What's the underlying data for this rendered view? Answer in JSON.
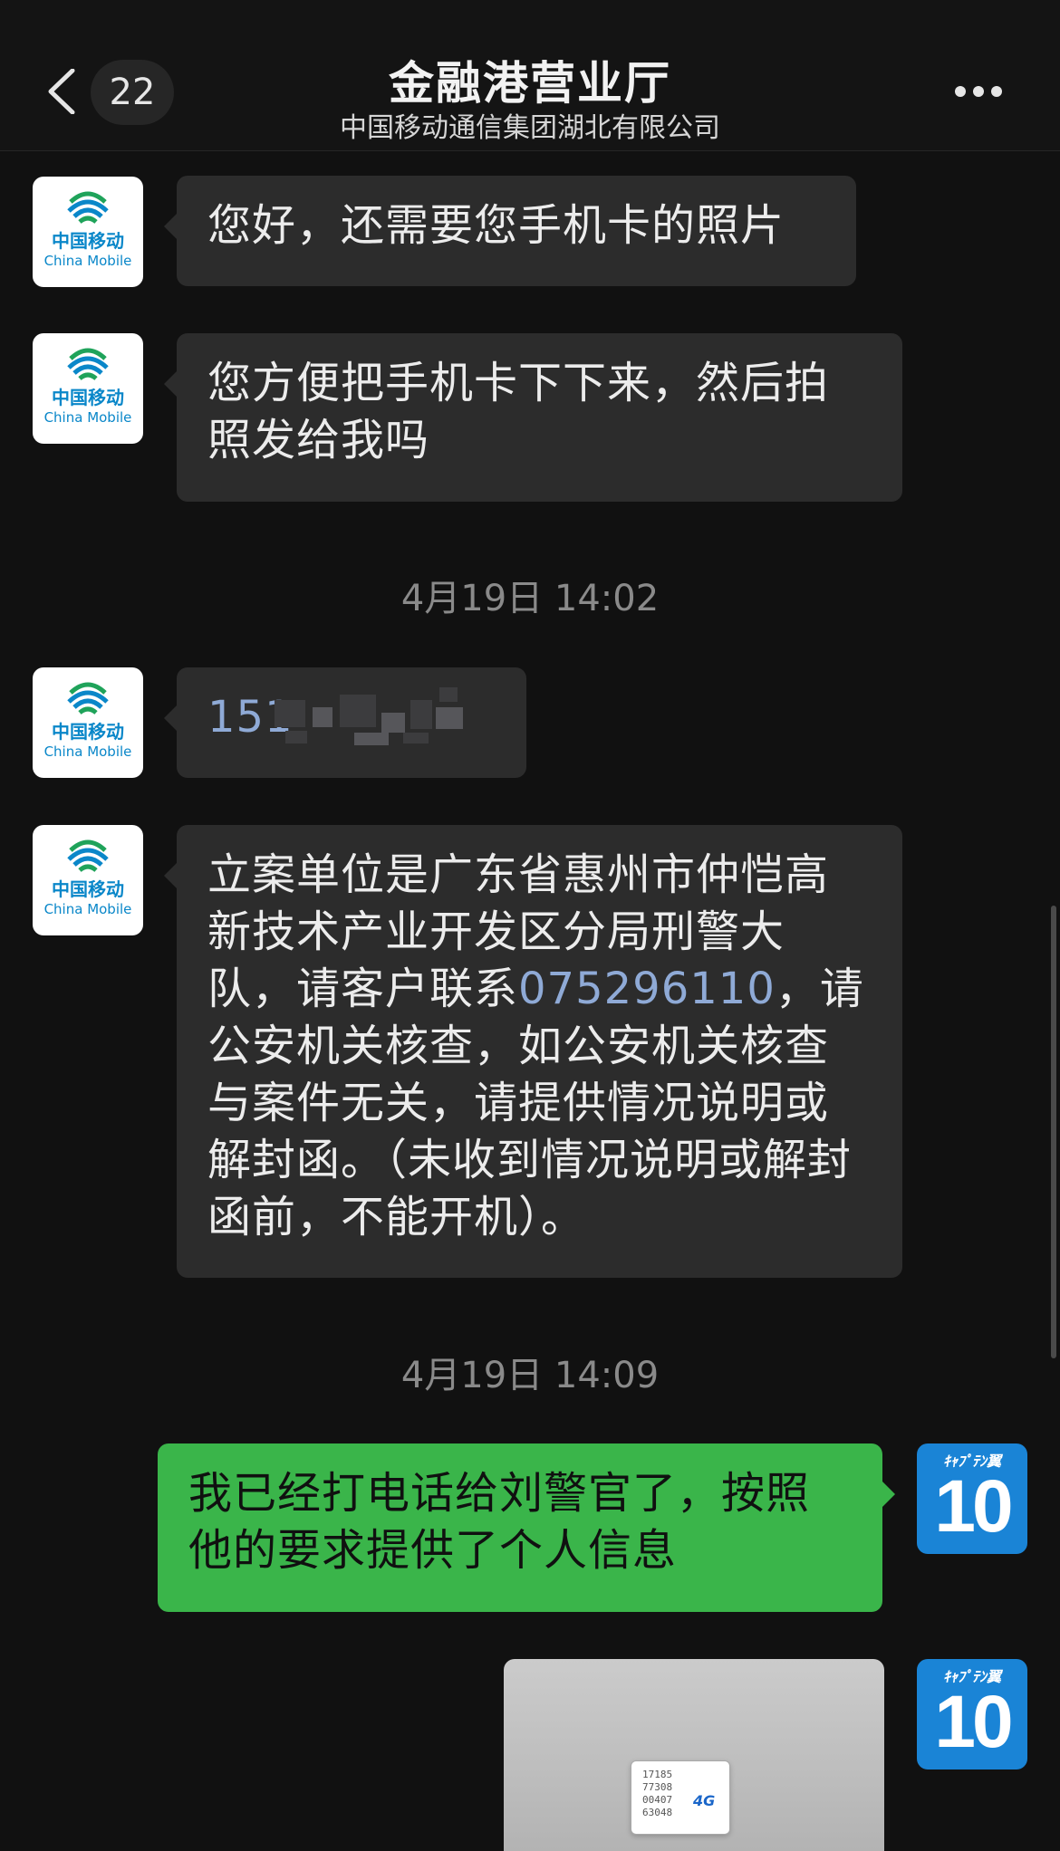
{
  "header": {
    "back_icon": "chevron-left-icon",
    "unread_count": "22",
    "title": "金融港营业厅",
    "subtitle": "中国移动通信集团湖北有限公司",
    "more_icon": "ellipsis-icon"
  },
  "contact_avatar": {
    "brand_cn": "中国移动",
    "brand_en": "China Mobile",
    "brand_color": "#0a87c9"
  },
  "my_avatar": {
    "top_text": "ｷｬﾌﾟﾃﾝ翼",
    "number": "10",
    "color": "#1a84d6"
  },
  "messages": [
    {
      "direction": "in",
      "text": "您好，还需要您手机卡的照片"
    },
    {
      "direction": "in",
      "text": "您方便把手机卡下下来，然后拍照发给我吗"
    },
    {
      "type": "timestamp",
      "text": "4月19日 14:02"
    },
    {
      "direction": "in",
      "text": "151",
      "redacted": true
    },
    {
      "direction": "in",
      "text_part1": "立案单位是广东省惠州市仲恺高新技术产业开发区分局刑警大队，请客户联系",
      "phone_link": "075296110",
      "text_part2": "，请公安机关核查，如公安机关核查与案件无关，请提供情况说明或解封函。（未收到情况说明或解封函前，不能开机）。"
    },
    {
      "type": "timestamp",
      "text": "4月19日 14:09"
    },
    {
      "direction": "out",
      "text": "我已经打电话给刘警官了，按照他的要求提供了个人信息"
    },
    {
      "direction": "out",
      "type": "image",
      "sim_code": "17185\n77308\n00407\n63048",
      "sim_label": "4G"
    }
  ],
  "colors": {
    "background": "#111111",
    "incoming_bubble": "#2c2c2c",
    "outgoing_bubble": "#3ab54a",
    "link": "#8faad6",
    "timestamp": "#8a8a8a"
  }
}
